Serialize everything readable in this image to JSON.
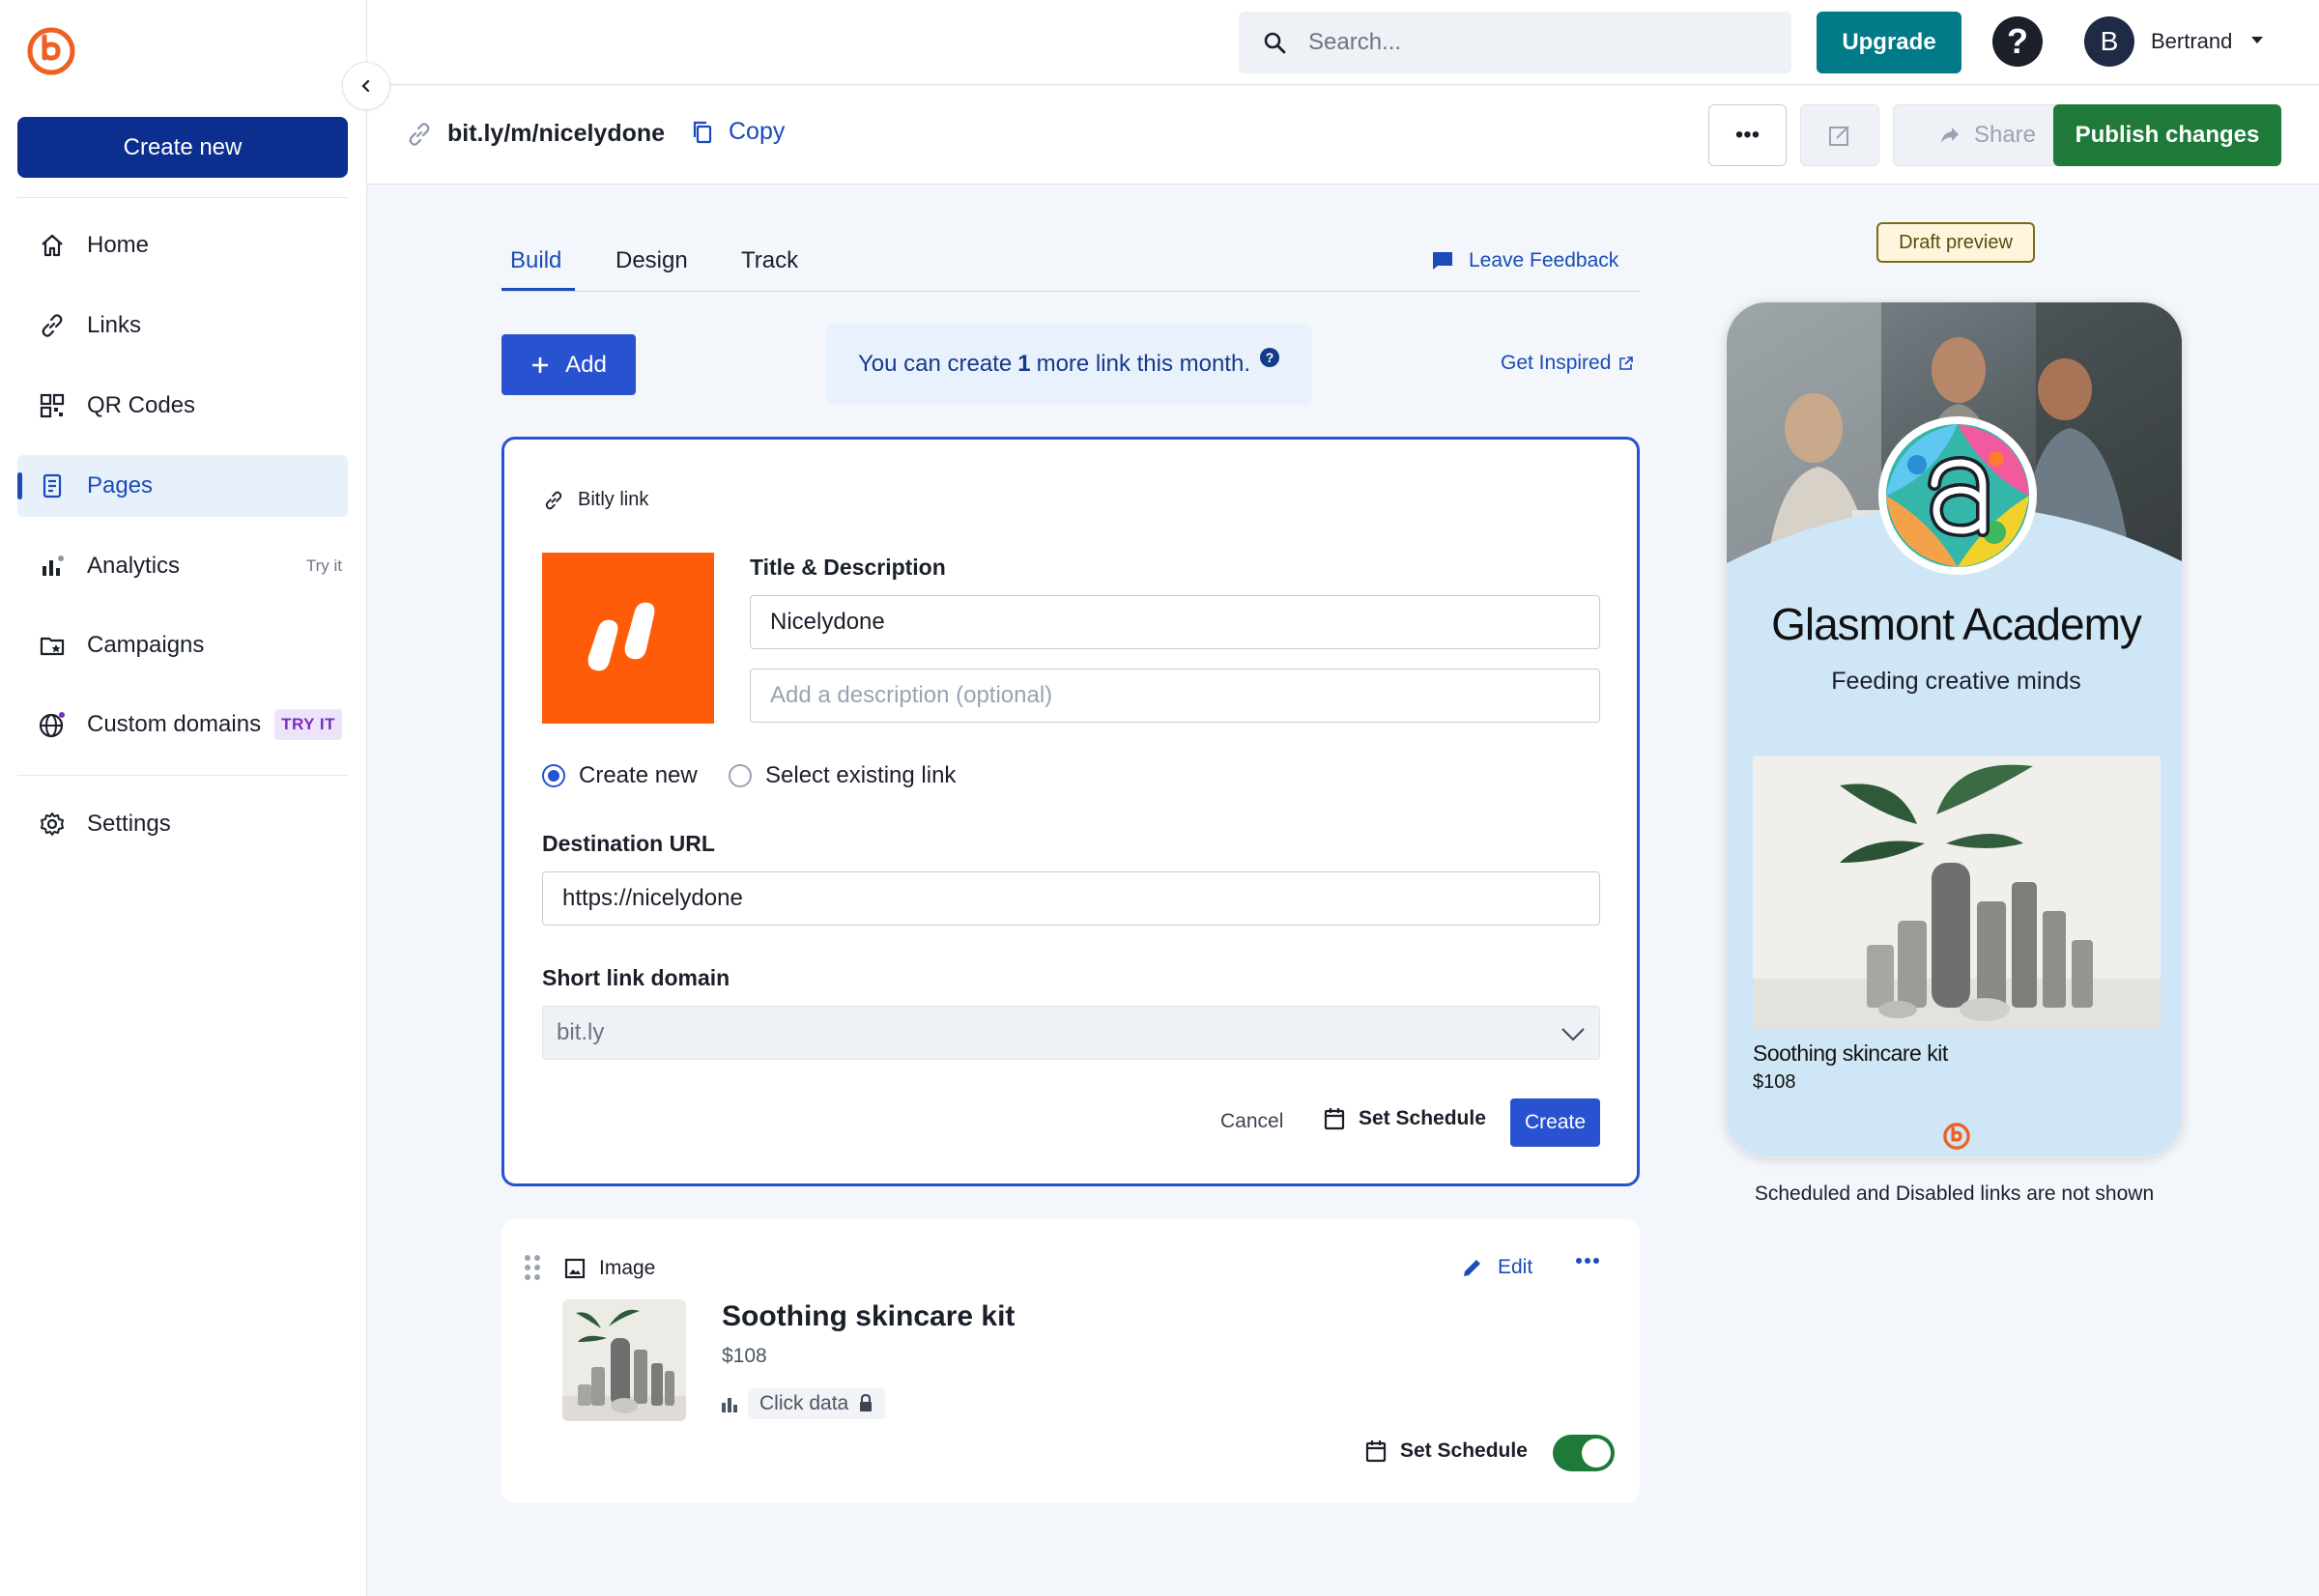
{
  "app": {
    "brand_color": "#ee6123"
  },
  "sidebar": {
    "create_new_label": "Create new",
    "items": [
      {
        "label": "Home",
        "icon": "home-icon"
      },
      {
        "label": "Links",
        "icon": "link-icon"
      },
      {
        "label": "QR Codes",
        "icon": "qr-code-icon"
      },
      {
        "label": "Pages",
        "icon": "pages-icon",
        "active": true
      },
      {
        "label": "Analytics",
        "icon": "analytics-icon",
        "extra": "Try it"
      },
      {
        "label": "Campaigns",
        "icon": "campaigns-icon"
      },
      {
        "label": "Custom domains",
        "icon": "globe-icon",
        "badge": "TRY IT"
      },
      {
        "label": "Settings",
        "icon": "gear-icon"
      }
    ]
  },
  "header": {
    "search_placeholder": "Search...",
    "upgrade_label": "Upgrade",
    "help_label": "?",
    "avatar_initial": "B",
    "user_name": "Bertrand"
  },
  "subheader": {
    "page_url": "bit.ly/m/nicelydone",
    "copy_label": "Copy",
    "more_label": "•••",
    "share_label": "Share",
    "publish_label": "Publish changes"
  },
  "tabs": {
    "build": "Build",
    "design": "Design",
    "track": "Track",
    "feedback": "Leave Feedback"
  },
  "toolbar": {
    "add_label": "Add",
    "limit_prefix": "You can create",
    "limit_count": "1",
    "limit_suffix": "more link this month.",
    "limit_help": "?",
    "get_inspired": "Get Inspired"
  },
  "link_card": {
    "type_label": "Bitly link",
    "title_label": "Title & Description",
    "title_value": "Nicelydone",
    "description_placeholder": "Add a description (optional)",
    "radio_create": "Create new",
    "radio_existing": "Select existing link",
    "destination_label": "Destination URL",
    "destination_value": "https://nicelydone",
    "domain_label": "Short link domain",
    "domain_value": "bit.ly",
    "cancel_label": "Cancel",
    "schedule_label": "Set Schedule",
    "create_label": "Create"
  },
  "image_card": {
    "type_label": "Image",
    "edit_label": "Edit",
    "more_label": "•••",
    "title": "Soothing skincare kit",
    "price": "$108",
    "click_data_label": "Click data",
    "schedule_label": "Set Schedule",
    "enabled": true
  },
  "preview": {
    "badge": "Draft preview",
    "org_name": "Glasmont Academy",
    "tagline": "Feeding creative minds",
    "product_name": "Soothing skincare kit",
    "product_price": "$108",
    "note": "Scheduled and Disabled links are not shown"
  },
  "colors": {
    "primary_blue": "#2952d1",
    "dark_blue": "#0c2e8f",
    "teal": "#007a87",
    "publish_green": "#1f7a3a",
    "orange": "#ff5c0a"
  }
}
